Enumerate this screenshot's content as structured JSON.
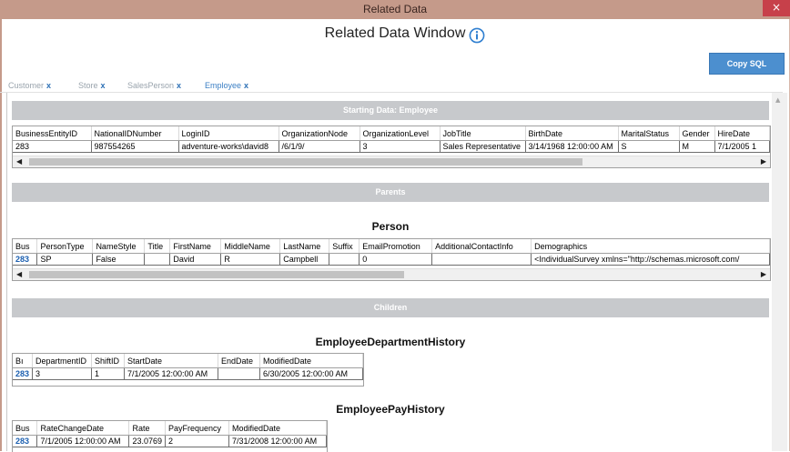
{
  "window": {
    "title": "Related Data",
    "close": "×"
  },
  "heading": "Related Data Window",
  "copy_button": "Copy SQL",
  "tabs": [
    {
      "label": "Customer",
      "x": "x"
    },
    {
      "label": "Store",
      "x": "x"
    },
    {
      "label": "SalesPerson",
      "x": "x"
    },
    {
      "label": "Employee",
      "x": "x"
    }
  ],
  "sections": {
    "starting": "Starting Data:   Employee",
    "parents": "Parents",
    "children": "Children"
  },
  "starting_grid": {
    "columns": [
      "BusinessEntityID",
      "NationalIDNumber",
      "LoginID",
      "OrganizationNode",
      "OrganizationLevel",
      "JobTitle",
      "BirthDate",
      "MaritalStatus",
      "Gender",
      "HireDate"
    ],
    "row": [
      "283",
      "987554265",
      "adventure-works\\david8",
      "/6/1/9/",
      "3",
      "Sales Representative",
      "3/14/1968 12:00:00 AM",
      "S",
      "M",
      "7/1/2005 1"
    ]
  },
  "person": {
    "title": "Person",
    "columns": [
      "Bus",
      "PersonType",
      "NameStyle",
      "Title",
      "FirstName",
      "MiddleName",
      "LastName",
      "Suffix",
      "EmailPromotion",
      "AdditionalContactInfo",
      "Demographics"
    ],
    "row": [
      "283",
      "SP",
      "False",
      "",
      "David",
      "R",
      "Campbell",
      "",
      "0",
      "",
      "<IndividualSurvey xmlns=\"http://schemas.microsoft.com/"
    ]
  },
  "dept_history": {
    "title": "EmployeeDepartmentHistory",
    "columns": [
      "Bı",
      "DepartmentID",
      "ShiftID",
      "StartDate",
      "EndDate",
      "ModifiedDate"
    ],
    "row": [
      "283",
      "3",
      "1",
      "7/1/2005 12:00:00 AM",
      "",
      "6/30/2005 12:00:00 AM"
    ]
  },
  "pay_history": {
    "title": "EmployeePayHistory",
    "columns": [
      "Bus",
      "RateChangeDate",
      "Rate",
      "PayFrequency",
      "ModifiedDate"
    ],
    "row": [
      "283",
      "7/1/2005 12:00:00 AM",
      "23.0769",
      "2",
      "7/31/2008 12:00:00 AM"
    ]
  },
  "scroll": {
    "left": "◀",
    "right": "▶",
    "up": "▲"
  },
  "colors": {
    "accent": "#4c8fcf",
    "titlebar": "#c59a8a",
    "close": "#c7404a",
    "band": "#c7c9cc"
  }
}
